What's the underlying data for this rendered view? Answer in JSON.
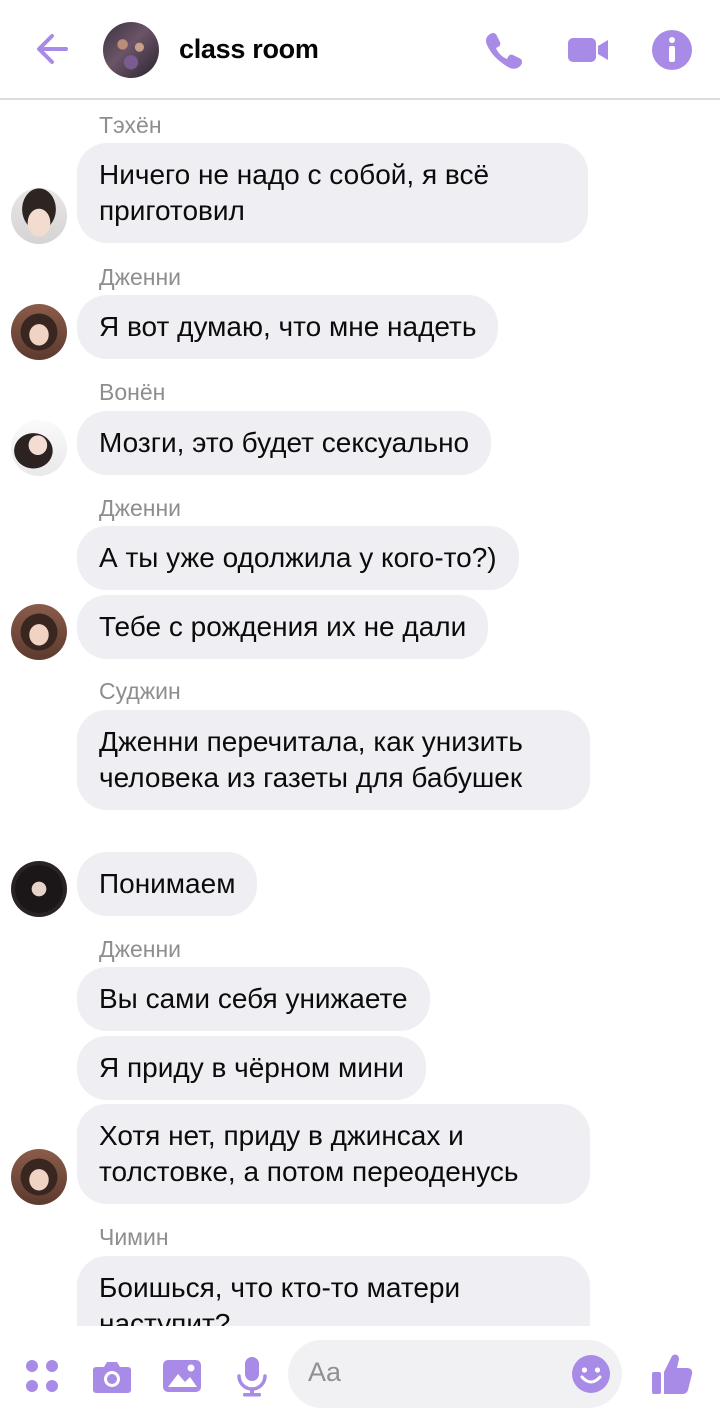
{
  "header": {
    "back_icon": "arrow-left-icon",
    "title": "class room",
    "actions": [
      "phone-icon",
      "video-camera-icon",
      "info-icon"
    ]
  },
  "accent_color": "#a78be6",
  "messages": [
    {
      "sender": "Тэхён",
      "texts": [
        "Ничего не надо с собой, я всё приготовил"
      ]
    },
    {
      "sender": "Дженни",
      "texts": [
        "Я вот думаю, что мне надеть"
      ]
    },
    {
      "sender": "Вонён",
      "texts": [
        "Мозги, это будет сексуально"
      ]
    },
    {
      "sender": "Дженни",
      "texts": [
        "А ты уже одолжила у кого-то?)",
        "Тебе с рождения их не дали"
      ]
    },
    {
      "sender": "Суджин",
      "texts": [
        "Дженни перечитала, как унизить человека из газеты для бабушек",
        "Понимаем"
      ]
    },
    {
      "sender": "Дженни",
      "texts": [
        "Вы сами себя унижаете",
        "Я приду в чёрном мини",
        "Хотя нет, приду в джинсах и толстовке, а потом переоденусь"
      ]
    },
    {
      "sender": "Чимин",
      "texts": [
        "Боишься, что кто-то матери наступит?"
      ]
    }
  ],
  "composer": {
    "placeholder": "Aa",
    "icons": [
      "apps-icon",
      "camera-icon",
      "image-icon",
      "microphone-icon",
      "emoji-icon",
      "thumbs-up-icon"
    ]
  }
}
